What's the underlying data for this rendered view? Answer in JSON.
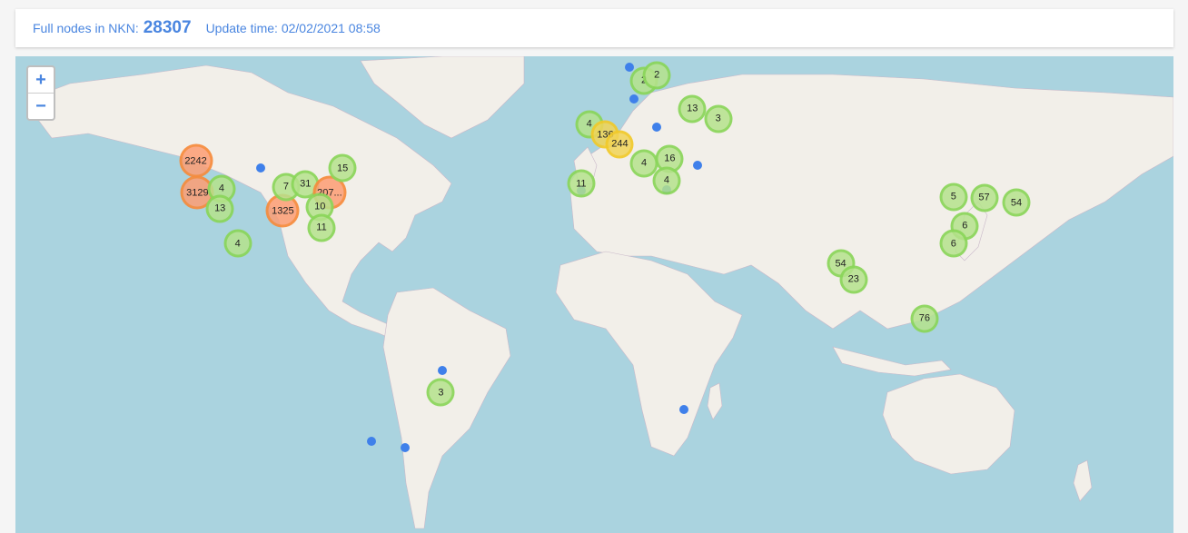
{
  "header": {
    "label": "Full nodes in NKN:",
    "count": "28307",
    "update_text": "Update time: 02/02/2021 08:58"
  },
  "zoom": {
    "in_label": "+",
    "out_label": "−"
  },
  "colors": {
    "water": "#aad3df",
    "land": "#f2efe9",
    "accent": "#4a86e0",
    "dot": "#3f80ea"
  },
  "clusters": [
    {
      "label": "2242",
      "size": "large",
      "lon": -123.5,
      "lat": 45.0
    },
    {
      "label": "3129",
      "size": "large",
      "lon": -123.0,
      "lat": 37.5
    },
    {
      "label": "4",
      "size": "small",
      "lon": -115.5,
      "lat": 38.5
    },
    {
      "label": "13",
      "size": "small",
      "lon": -116.0,
      "lat": 33.5
    },
    {
      "label": "1325",
      "size": "large",
      "lon": -96.5,
      "lat": 33.0
    },
    {
      "label": "7",
      "size": "small",
      "lon": -95.5,
      "lat": 39.0
    },
    {
      "label": "31",
      "size": "small",
      "lon": -89.5,
      "lat": 39.7
    },
    {
      "label": "207...",
      "size": "large",
      "lon": -82.0,
      "lat": 37.5
    },
    {
      "label": "15",
      "size": "small",
      "lon": -78.0,
      "lat": 43.3
    },
    {
      "label": "10",
      "size": "small",
      "lon": -85.0,
      "lat": 34.0
    },
    {
      "label": "11",
      "size": "small",
      "lon": -84.5,
      "lat": 28.5
    },
    {
      "label": "4",
      "size": "small",
      "lon": -110.5,
      "lat": 24.0
    },
    {
      "label": "3",
      "size": "small",
      "lon": -47.5,
      "lat": -21.0
    },
    {
      "label": "4",
      "size": "small",
      "lon": -1.5,
      "lat": 52.5
    },
    {
      "label": "136",
      "size": "medium",
      "lon": 3.5,
      "lat": 50.5
    },
    {
      "label": "244",
      "size": "medium",
      "lon": 8.0,
      "lat": 48.5
    },
    {
      "label": "11",
      "size": "small",
      "lon": -4.0,
      "lat": 39.8
    },
    {
      "label": "4",
      "size": "small",
      "lon": 15.5,
      "lat": 44.5
    },
    {
      "label": "16",
      "size": "small",
      "lon": 23.5,
      "lat": 45.5
    },
    {
      "label": "4",
      "size": "small",
      "lon": 22.5,
      "lat": 40.5
    },
    {
      "label": "2",
      "size": "small",
      "lon": 15.5,
      "lat": 60.0
    },
    {
      "label": "2",
      "size": "small",
      "lon": 19.5,
      "lat": 60.8
    },
    {
      "label": "13",
      "size": "small",
      "lon": 30.5,
      "lat": 55.3
    },
    {
      "label": "3",
      "size": "small",
      "lon": 38.5,
      "lat": 53.5
    },
    {
      "label": "54",
      "size": "small",
      "lon": 76.5,
      "lat": 18.2
    },
    {
      "label": "23",
      "size": "small",
      "lon": 80.5,
      "lat": 13.5
    },
    {
      "label": "76",
      "size": "small",
      "lon": 102.5,
      "lat": 1.5
    },
    {
      "label": "5",
      "size": "small",
      "lon": 111.5,
      "lat": 36.5
    },
    {
      "label": "57",
      "size": "small",
      "lon": 121.0,
      "lat": 36.3
    },
    {
      "label": "54",
      "size": "small",
      "lon": 131.0,
      "lat": 35.0
    },
    {
      "label": "6",
      "size": "small",
      "lon": 115.0,
      "lat": 29.0
    },
    {
      "label": "6",
      "size": "small",
      "lon": 111.5,
      "lat": 24.0
    }
  ],
  "markers": [
    {
      "lon": -103.5,
      "lat": 43.5
    },
    {
      "lon": -69.0,
      "lat": -34.5
    },
    {
      "lon": -58.5,
      "lat": -36.0
    },
    {
      "lon": -47.0,
      "lat": -14.5
    },
    {
      "lon": -4.0,
      "lat": 38.0
    },
    {
      "lon": 11.0,
      "lat": 62.0
    },
    {
      "lon": 12.5,
      "lat": 57.0
    },
    {
      "lon": 19.5,
      "lat": 52.0
    },
    {
      "lon": 32.0,
      "lat": 44.0
    },
    {
      "lon": 22.5,
      "lat": 38.2
    },
    {
      "lon": 28.0,
      "lat": -26.0
    }
  ]
}
